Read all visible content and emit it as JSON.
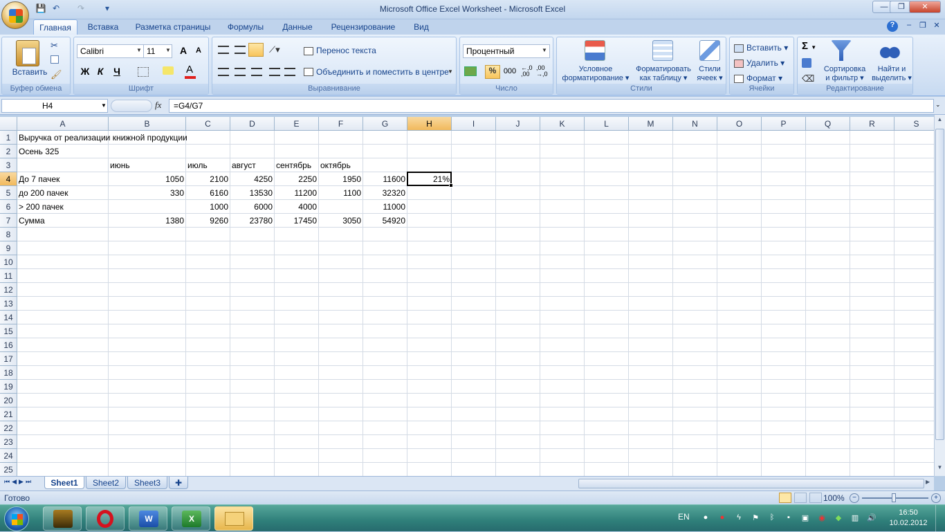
{
  "window": {
    "title": "Microsoft Office Excel Worksheet - Microsoft Excel"
  },
  "qat": {
    "save": "💾",
    "undo": "↶",
    "redo": "↷",
    "more": "▾"
  },
  "winbtns": {
    "min": "—",
    "max": "❐",
    "close": "✕"
  },
  "tabs": [
    "Главная",
    "Вставка",
    "Разметка страницы",
    "Формулы",
    "Данные",
    "Рецензирование",
    "Вид"
  ],
  "ribbon": {
    "clipboard": {
      "paste": "Вставить",
      "label": "Буфер обмена"
    },
    "font": {
      "name": "Calibri",
      "size": "11",
      "bold": "Ж",
      "italic": "К",
      "underline": "Ч",
      "label": "Шрифт",
      "grow": "A",
      "shrink": "A"
    },
    "alignment": {
      "wrap": "Перенос текста",
      "merge": "Объединить и поместить в центре",
      "label": "Выравнивание"
    },
    "number": {
      "format": "Процентный",
      "percent": "%",
      "thousands": "000",
      "label": "Число"
    },
    "styles": {
      "conditional": "Условное",
      "conditional2": "форматирование",
      "astable": "Форматировать",
      "astable2": "как таблицу",
      "cell": "Стили",
      "cell2": "ячеек",
      "label": "Стили"
    },
    "cells": {
      "insert": "Вставить",
      "delete": "Удалить",
      "format": "Формат",
      "label": "Ячейки"
    },
    "editing": {
      "sort": "Сортировка",
      "sort2": "и фильтр",
      "find": "Найти и",
      "find2": "выделить",
      "label": "Редактирование",
      "sum": "Σ"
    }
  },
  "formula_bar": {
    "name_box": "H4",
    "fx": "fx",
    "formula": "=G4/G7"
  },
  "columns": [
    "A",
    "B",
    "C",
    "D",
    "E",
    "F",
    "G",
    "H",
    "I",
    "J",
    "K",
    "L",
    "M",
    "N",
    "O",
    "P",
    "Q",
    "R",
    "S"
  ],
  "rows": [
    "1",
    "2",
    "3",
    "4",
    "5",
    "6",
    "7",
    "8",
    "9",
    "10",
    "11",
    "12",
    "13",
    "14",
    "15",
    "16",
    "17",
    "18",
    "19",
    "20",
    "21",
    "22",
    "23",
    "24",
    "25"
  ],
  "cells": {
    "A1": "Выручка от реализации книжной продукции",
    "A2": "Осень 325",
    "B3": "июнь",
    "C3": "июль",
    "D3": "август",
    "E3": "сентябрь",
    "F3": "октябрь",
    "A4": "До 7 пачек",
    "B4": "1050",
    "C4": "2100",
    "D4": "4250",
    "E4": "2250",
    "F4": "1950",
    "G4": "11600",
    "H4": "21%",
    "A5": "до 200 пачек",
    "B5": "330",
    "C5": "6160",
    "D5": "13530",
    "E5": "11200",
    "F5": "1100",
    "G5": "32320",
    "A6": "> 200 пачек",
    "C6": "1000",
    "D6": "6000",
    "E6": "4000",
    "G6": "11000",
    "A7": "Сумма",
    "B7": "1380",
    "C7": "9260",
    "D7": "23780",
    "E7": "17450",
    "F7": "3050",
    "G7": "54920"
  },
  "sheets": [
    "Sheet1",
    "Sheet2",
    "Sheet3"
  ],
  "status": {
    "ready": "Готово",
    "zoom": "100%"
  },
  "taskbar": {
    "lang": "EN",
    "time": "16:50",
    "date": "10.02.2012"
  }
}
